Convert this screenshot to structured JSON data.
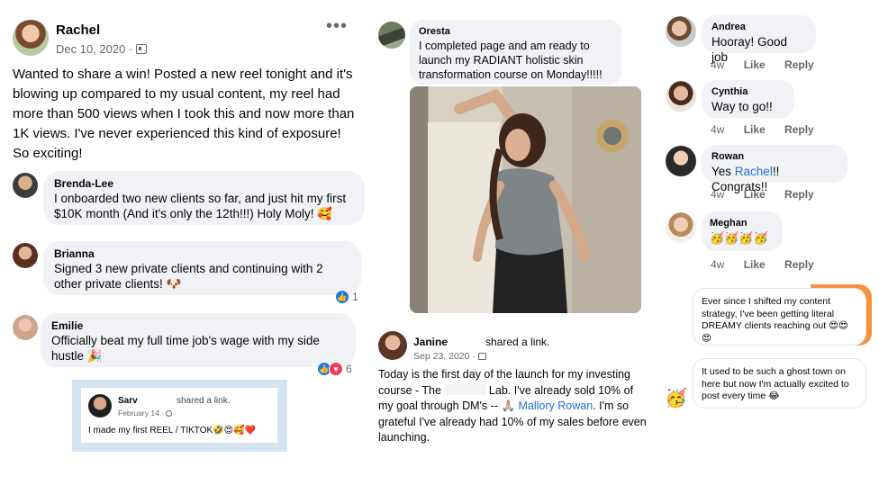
{
  "post": {
    "author": "Rachel",
    "date": "Dec 10, 2020 ·",
    "body": "Wanted to share a win! Posted a new reel tonight and it's blowing up compared to my usual content, my reel had more than 500 views when I took this and now more than 1K views. I've never experienced this kind of exposure! So exciting!"
  },
  "left_comments": [
    {
      "name": "Brenda-Lee",
      "text": "I onboarded two new clients so far, and just hit my first $10K month (And it's only the 12th!!!) Holy Moly! 🥰"
    },
    {
      "name": "Brianna",
      "text": "Signed 3 new private clients and continuing with 2 other private clients! 🐶",
      "react_count": "1"
    },
    {
      "name": "Emilie",
      "text": "Officially beat my full time job's wage with my side hustle 🎉",
      "react_count": "6"
    }
  ],
  "shared": {
    "name": "Sarv",
    "action": "shared a link.",
    "date": "February 14 ·",
    "text": "I made my first REEL / TIKTOK🤣😍🥰❤️"
  },
  "oresta": {
    "name": "Oresta",
    "text": "I completed page and am ready to launch my RADIANT holistic skin transformation course on Monday!!!!!"
  },
  "janine": {
    "name": "Janine",
    "action": "shared a link.",
    "date": "Sep 23, 2020 ·",
    "body_pre": "Today is the first day of the launch for my investing course - The",
    "body_mid": "Lab. I've already sold 10% of my goal through DM's -- 🙏🏼",
    "mention": "Mallory Rowan",
    "body_post": ". I'm so grateful I've already had 10% of my sales before even launching."
  },
  "right_comments": [
    {
      "name": "Andrea",
      "text": "Hooray! Good job",
      "age": "4w",
      "like": "Like",
      "reply": "Reply"
    },
    {
      "name": "Cynthia",
      "text": "Way to go!!",
      "age": "4w",
      "like": "Like",
      "reply": "Reply"
    },
    {
      "name": "Rowan",
      "text_pre": "Yes",
      "mention": "Rachel",
      "text_post": "!! Congrats!!",
      "age": "4w",
      "like": "Like",
      "reply": "Reply"
    },
    {
      "name": "Meghan",
      "text": "🥳🥳🥳🥳",
      "age": "4w",
      "like": "Like",
      "reply": "Reply"
    }
  ],
  "messages": [
    {
      "text": "Ever since I shifted my content strategy, I've been getting literal DREAMY clients reaching out 😍😍 😍"
    },
    {
      "text": "It used to be such a ghost town on here but now I'm actually excited to post every time 😂"
    }
  ],
  "colors": {
    "bubble": "#f0f2f5",
    "link": "#216fdb",
    "like_blue": "#1877f2",
    "love_red": "#f33e58",
    "shared_frame": "#d6e4f2",
    "orange_accent": "#f5923e"
  }
}
